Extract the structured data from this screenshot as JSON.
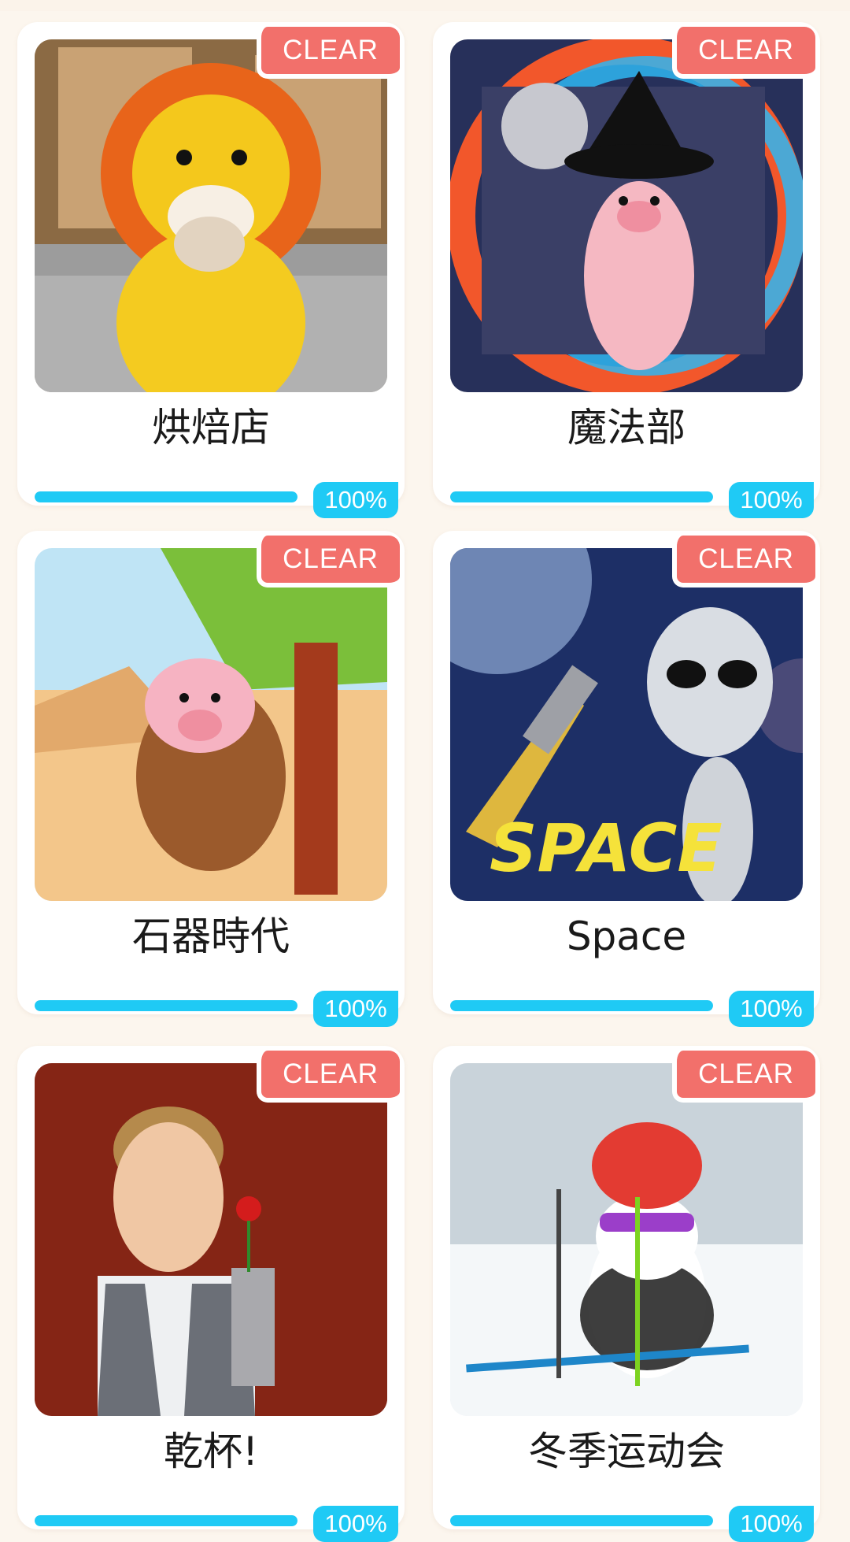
{
  "cards": [
    {
      "title": "烘焙店",
      "badge": "CLEAR",
      "progress_label": "100%",
      "progress": 1.0
    },
    {
      "title": "魔法部",
      "badge": "CLEAR",
      "progress_label": "100%",
      "progress": 1.0
    },
    {
      "title": "石器時代",
      "badge": "CLEAR",
      "progress_label": "100%",
      "progress": 1.0
    },
    {
      "title": "Space",
      "badge": "CLEAR",
      "progress_label": "100%",
      "progress": 1.0,
      "art_text": "SPACE"
    },
    {
      "title": "乾杯!",
      "badge": "CLEAR",
      "progress_label": "100%",
      "progress": 1.0
    },
    {
      "title": "冬季运动会",
      "badge": "CLEAR",
      "progress_label": "100%",
      "progress": 1.0
    }
  ],
  "colors": {
    "background": "#fcf6ee",
    "clear_badge": "#f2706b",
    "progress": "#1fcaf5"
  }
}
